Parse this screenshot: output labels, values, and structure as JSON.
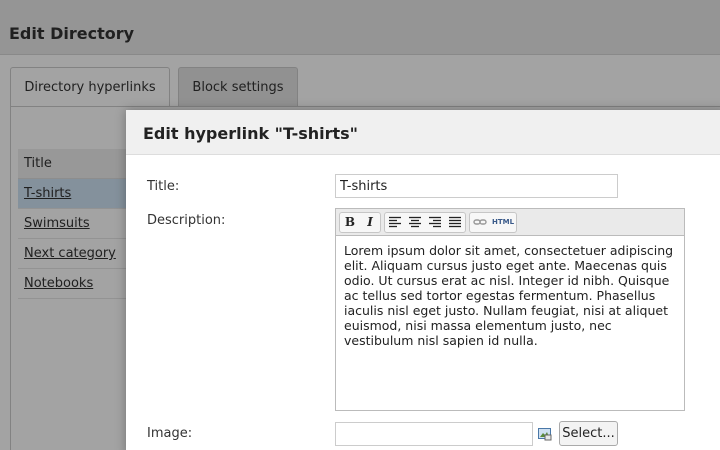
{
  "page": {
    "title": "Edit Directory",
    "tabs": [
      "Directory hyperlinks",
      "Block settings"
    ],
    "list_header": "Title",
    "list_items": [
      "T-shirts",
      "Swimsuits",
      "Next category",
      "Notebooks"
    ]
  },
  "dialog": {
    "title": "Edit hyperlink \"T-shirts\"",
    "title_label": "Title:",
    "title_value": "T-shirts",
    "description_label": "Description:",
    "description_text": "Lorem ipsum dolor sit amet, consectetuer adipiscing elit. Aliquam cursus justo eget ante. Maecenas quis odio. Ut cursus erat ac nisl. Integer id nibh. Quisque ac tellus sed tortor egestas fermentum. Phasellus iaculis nisl eget justo. Nullam feugiat, nisi at aliquet euismod, nisi massa elementum justo, nec vestibulum nisl sapien id nulla.",
    "toolbar": {
      "bold": "B",
      "italic": "I",
      "html": "HTML"
    },
    "image_label": "Image:",
    "image_value": "",
    "select_button": "Select..."
  },
  "colors": {
    "selected_row": "#cfe3f5",
    "overlay": "rgba(0,0,0,0.36)"
  }
}
